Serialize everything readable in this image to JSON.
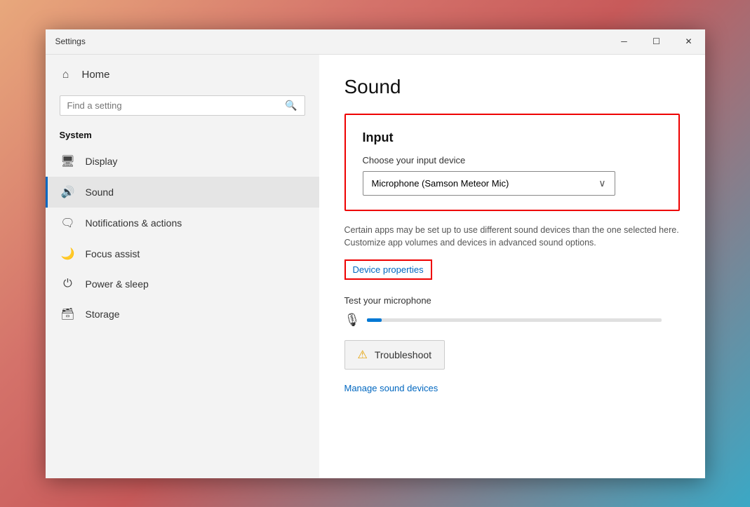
{
  "window": {
    "title": "Settings",
    "minimize_label": "─",
    "maximize_label": "☐",
    "close_label": "✕"
  },
  "sidebar": {
    "home_label": "Home",
    "home_icon": "⌂",
    "search_placeholder": "Find a setting",
    "section_title": "System",
    "items": [
      {
        "id": "display",
        "label": "Display",
        "icon": "🖥"
      },
      {
        "id": "sound",
        "label": "Sound",
        "icon": "🔊",
        "active": true
      },
      {
        "id": "notifications",
        "label": "Notifications & actions",
        "icon": "🗨"
      },
      {
        "id": "focus",
        "label": "Focus assist",
        "icon": "🌙"
      },
      {
        "id": "power",
        "label": "Power & sleep",
        "icon": "⏻"
      },
      {
        "id": "storage",
        "label": "Storage",
        "icon": "🗄"
      }
    ]
  },
  "main": {
    "page_title": "Sound",
    "input_section": {
      "heading": "Input",
      "device_label": "Choose your input device",
      "device_value": "Microphone (Samson Meteor Mic)",
      "description": "Certain apps may be set up to use different sound devices than the one selected here. Customize app volumes and devices in advanced sound options.",
      "device_properties_label": "Device properties",
      "test_mic_label": "Test your microphone",
      "troubleshoot_label": "Troubleshoot",
      "manage_link_label": "Manage sound devices"
    }
  },
  "icons": {
    "search": "🔍",
    "home": "⌂",
    "display": "🖥",
    "sound": "🔊",
    "notifications": "🗨",
    "focus": "🌙",
    "power": "⏻",
    "storage": "🗃",
    "mic": "🎙",
    "warning": "⚠"
  }
}
